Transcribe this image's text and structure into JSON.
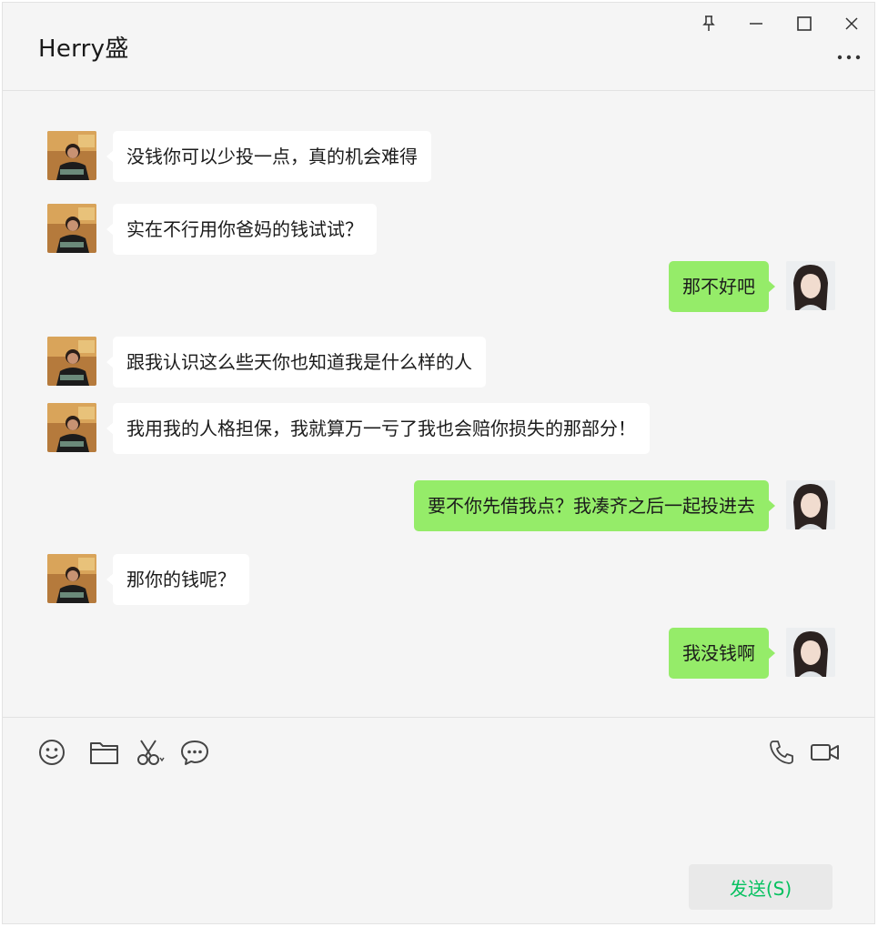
{
  "window": {
    "title": "Herry盛",
    "controls": [
      "pin-icon",
      "minimize-icon",
      "maximize-icon",
      "close-icon"
    ],
    "more_icon": "more-icon"
  },
  "messages": [
    {
      "side": "incoming",
      "text": "没钱你可以少投一点，真的机会难得"
    },
    {
      "side": "incoming",
      "text": "实在不行用你爸妈的钱试试？"
    },
    {
      "side": "outgoing",
      "text": "那不好吧"
    },
    {
      "side": "incoming",
      "text": "跟我认识这么些天你也知道我是什么样的人"
    },
    {
      "side": "incoming",
      "text": "我用我的人格担保，我就算万一亏了我也会赔你损失的那部分！"
    },
    {
      "side": "outgoing",
      "text": "要不你先借我点？我凑齐之后一起投进去"
    },
    {
      "side": "incoming",
      "text": "那你的钱呢？"
    },
    {
      "side": "outgoing",
      "text": "我没钱啊"
    }
  ],
  "toolbar": {
    "left_icons": [
      "emoji-icon",
      "folder-icon",
      "scissors-icon",
      "chat-bubble-icon"
    ],
    "right_icons": [
      "phone-icon",
      "video-icon"
    ]
  },
  "input": {
    "value": ""
  },
  "send_button": {
    "label": "发送(S)"
  },
  "colors": {
    "outgoing_bubble": "#95ec69",
    "incoming_bubble": "#ffffff",
    "send_text": "#07c160",
    "background": "#f5f5f5"
  }
}
